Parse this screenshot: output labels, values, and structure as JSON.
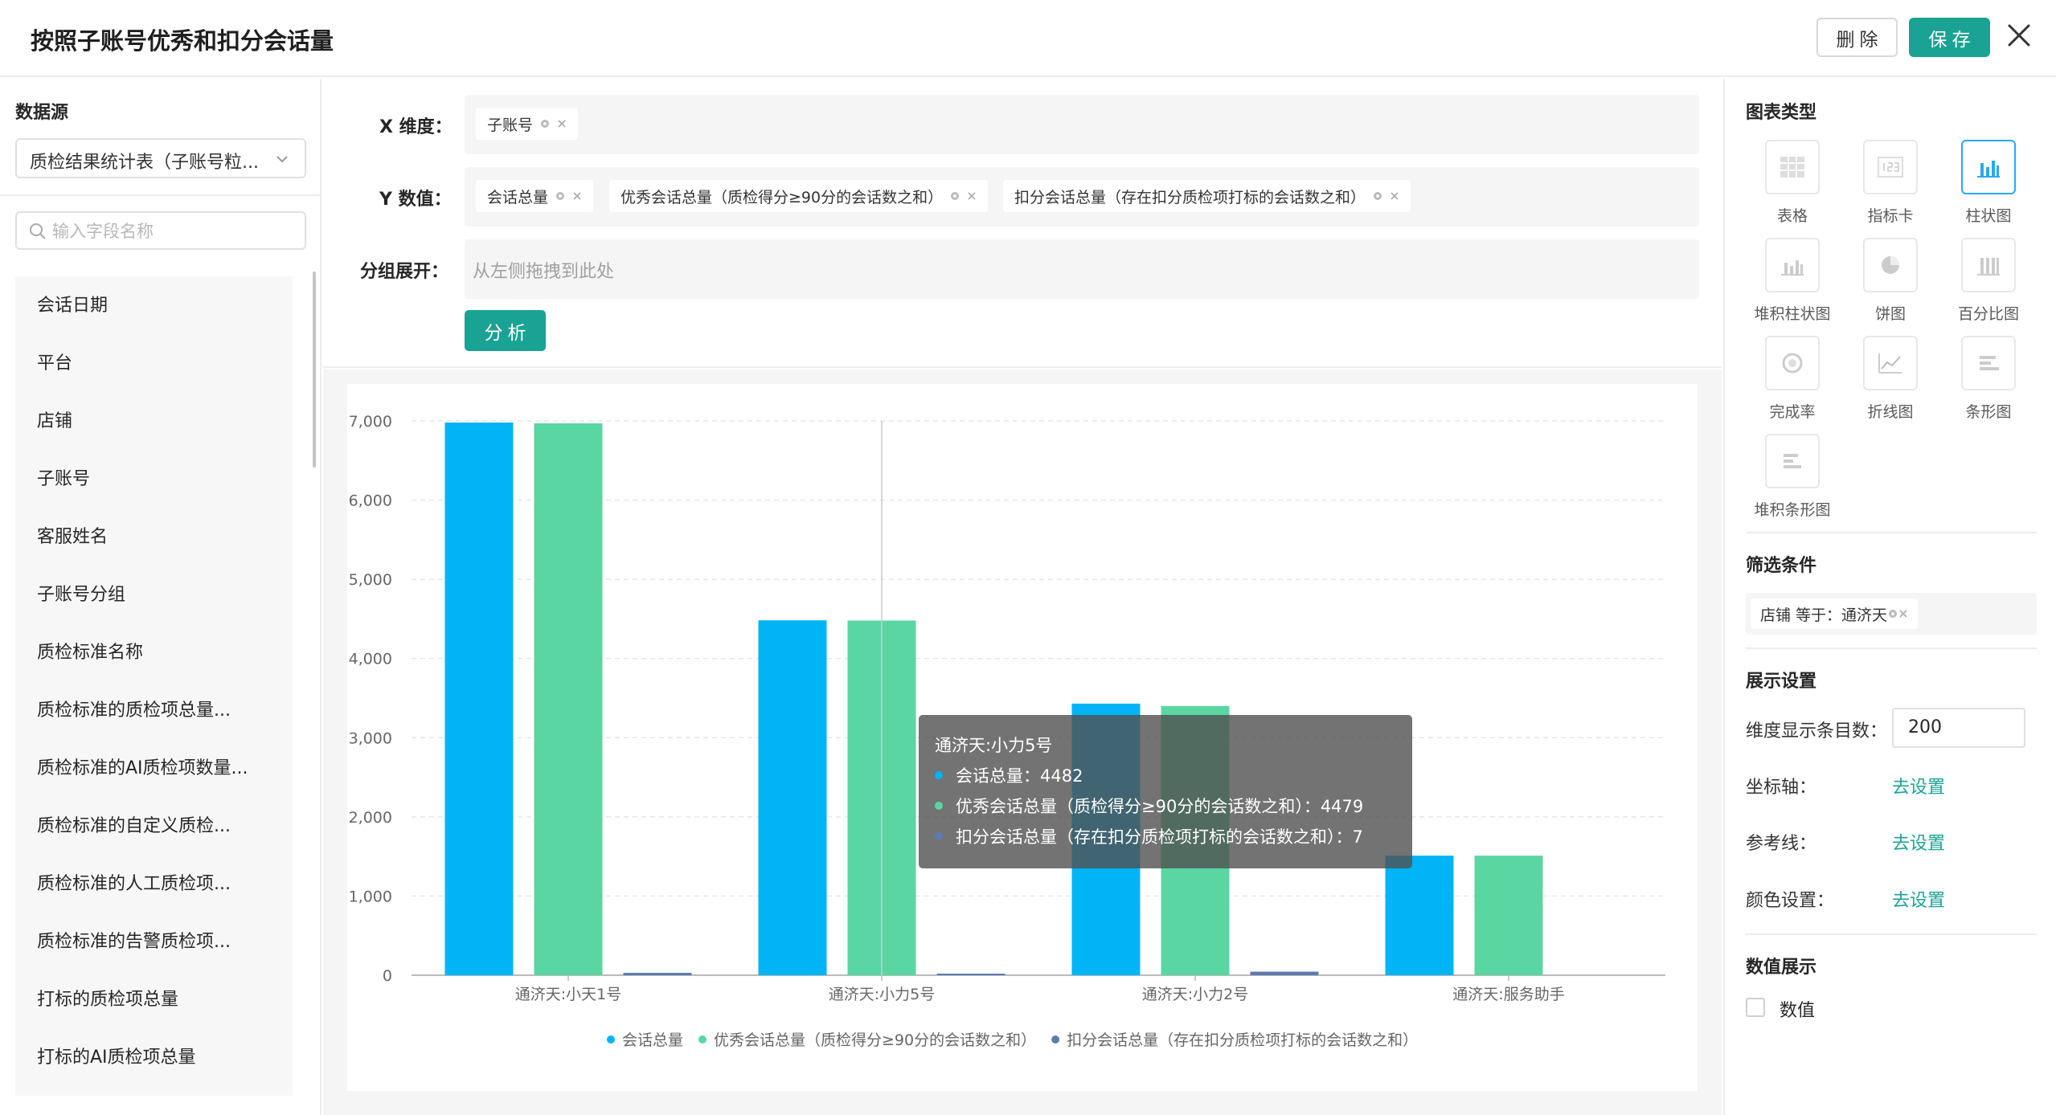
{
  "header": {
    "title": "按照子账号优秀和扣分会话量",
    "delete_label": "删除",
    "save_label": "保存"
  },
  "left": {
    "datasource_label": "数据源",
    "datasource_value": "质检结果统计表（子账号粒...",
    "search_placeholder": "输入字段名称",
    "fields": [
      "会话日期",
      "平台",
      "店铺",
      "子账号",
      "客服姓名",
      "子账号分组",
      "质检标准名称",
      "质检标准的质检项总量...",
      "质检标准的AI质检项数量...",
      "质检标准的自定义质检...",
      "质检标准的人工质检项...",
      "质检标准的告警质检项...",
      "打标的质检项总量",
      "打标的AI质检项总量"
    ]
  },
  "config": {
    "x_label": "X 维度：",
    "x_tags": [
      "子账号"
    ],
    "y_label": "Y 数值：",
    "y_tags": [
      "会话总量",
      "优秀会话总量（质检得分≥90分的会话数之和）",
      "扣分会话总量（存在扣分质检项打标的会话数之和）"
    ],
    "group_label": "分组展开：",
    "group_placeholder": "从左侧拖拽到此处",
    "analyze_label": "分析"
  },
  "chart_data": {
    "type": "bar",
    "categories": [
      "通济天:小天1号",
      "通济天:小力5号",
      "通济天:小力2号",
      "通济天:服务助手"
    ],
    "series": [
      {
        "name": "会话总量",
        "values": [
          6980,
          4482,
          3430,
          1510
        ],
        "color": "#00b4f5"
      },
      {
        "name": "优秀会话总量（质检得分≥90分的会话数之和）",
        "values": [
          6970,
          4479,
          3400,
          1510
        ],
        "color": "#5ad6a3"
      },
      {
        "name": "扣分会话总量（存在扣分质检项打标的会话数之和）",
        "values": [
          30,
          7,
          45,
          0
        ],
        "color": "#5d7bb3"
      }
    ],
    "yticks": [
      "0",
      "1,000",
      "2,000",
      "3,000",
      "4,000",
      "5,000",
      "6,000",
      "7,000"
    ],
    "ylim": [
      0,
      7000
    ],
    "grid": true,
    "legend_position": "bottom"
  },
  "tooltip": {
    "title": "通济天:小力5号",
    "rows": [
      "会话总量：4482",
      "优秀会话总量（质检得分≥90分的会话数之和）：4479",
      "扣分会话总量（存在扣分质检项打标的会话数之和）：7"
    ]
  },
  "right": {
    "chart_type_title": "图表类型",
    "chart_types": [
      {
        "label": "表格",
        "icon": "table-icon"
      },
      {
        "label": "指标卡",
        "icon": "metric-card-icon"
      },
      {
        "label": "柱状图",
        "icon": "bar-chart-icon"
      },
      {
        "label": "堆积柱状图",
        "icon": "stacked-bar-icon"
      },
      {
        "label": "饼图",
        "icon": "pie-chart-icon"
      },
      {
        "label": "百分比图",
        "icon": "percent-chart-icon"
      },
      {
        "label": "完成率",
        "icon": "completion-rate-icon"
      },
      {
        "label": "折线图",
        "icon": "line-chart-icon"
      },
      {
        "label": "条形图",
        "icon": "horizontal-bar-icon"
      },
      {
        "label": "堆积条形图",
        "icon": "stacked-horizontal-bar-icon"
      }
    ],
    "filter_title": "筛选条件",
    "filter_tag": "店铺 等于：通济天",
    "display_title": "展示设置",
    "dim_count_label": "维度显示条目数：",
    "dim_count_value": "200",
    "axis_label": "坐标轴：",
    "refline_label": "参考线：",
    "color_label": "颜色设置：",
    "go_set": "去设置",
    "value_title": "数值展示",
    "value_checkbox": "数值"
  },
  "colors": {
    "accent": "#1aa394",
    "active_border": "#2aa8f2"
  }
}
